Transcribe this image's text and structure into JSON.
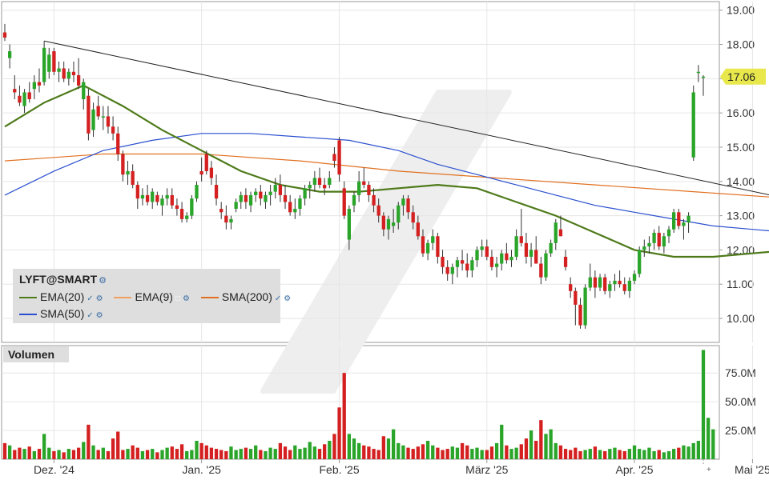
{
  "symbol": "LYFT@SMART",
  "colors": {
    "up": "#2aa52a",
    "down": "#d42020",
    "ema20": "#4e7a1a",
    "ema9": "#f0a060",
    "sma200": "#e07020",
    "sma50": "#2a4fcf",
    "trendline": "#222222",
    "last_price_bg": "#e8e84c"
  },
  "legend": {
    "title": "LYFT@SMART",
    "items": [
      {
        "label": "EMA(20)",
        "color": "#4e7a1a",
        "icons": [
          "check-icon",
          "gear-icon"
        ]
      },
      {
        "label": "EMA(9)",
        "color": "#f0a060",
        "icons": [
          "checkbox-empty-icon",
          "gear-icon"
        ]
      },
      {
        "label": "SMA(200)",
        "color": "#e07020",
        "icons": [
          "check-icon",
          "gear-icon"
        ]
      },
      {
        "label": "SMA(50)",
        "color": "#2a4fcf",
        "icons": [
          "check-icon",
          "gear-icon"
        ]
      }
    ]
  },
  "volume_panel": {
    "title": "Volumen"
  },
  "last_price_label": "17.06",
  "chart_data": {
    "type": "candlestick",
    "price_axis": {
      "ticks": [
        "10.00",
        "11.00",
        "12.00",
        "13.00",
        "14.00",
        "15.00",
        "16.00",
        "17.00",
        "18.00",
        "19.00"
      ],
      "range": [
        9.3,
        19.25
      ]
    },
    "volume_axis": {
      "ticks": [
        "25.0M",
        "50.0M",
        "75.0M"
      ],
      "range": [
        0,
        96
      ]
    },
    "x_labels": [
      "Dez. '24",
      "Jan. '25",
      "Feb. '25",
      "März '25",
      "Apr. '25",
      "Mai '25"
    ],
    "candles": [
      [
        18.35,
        18.6,
        18.1,
        18.2
      ],
      [
        17.6,
        18.0,
        17.3,
        17.8
      ],
      [
        16.7,
        17.1,
        16.4,
        16.6
      ],
      [
        16.5,
        16.8,
        16.2,
        16.3
      ],
      [
        16.2,
        16.7,
        16.0,
        16.6
      ],
      [
        16.6,
        16.9,
        16.3,
        16.4
      ],
      [
        16.7,
        17.1,
        16.4,
        16.9
      ],
      [
        16.9,
        17.3,
        16.6,
        16.8
      ],
      [
        16.9,
        18.1,
        16.8,
        17.9
      ],
      [
        17.2,
        17.9,
        17.0,
        17.7
      ],
      [
        17.8,
        17.9,
        17.1,
        17.2
      ],
      [
        17.2,
        17.5,
        16.9,
        17.3
      ],
      [
        17.3,
        17.5,
        16.9,
        17.0
      ],
      [
        17.0,
        17.3,
        16.8,
        17.2
      ],
      [
        17.2,
        17.5,
        16.9,
        17.1
      ],
      [
        17.1,
        17.6,
        16.7,
        16.8
      ],
      [
        16.4,
        17.0,
        16.1,
        16.9
      ],
      [
        16.5,
        16.7,
        15.2,
        15.4
      ],
      [
        15.5,
        16.3,
        15.3,
        16.1
      ],
      [
        16.2,
        16.5,
        15.8,
        15.9
      ],
      [
        15.9,
        16.2,
        15.5,
        15.9
      ],
      [
        15.9,
        16.2,
        15.4,
        15.6
      ],
      [
        15.6,
        15.9,
        15.2,
        15.4
      ],
      [
        15.4,
        15.6,
        14.6,
        14.8
      ],
      [
        14.8,
        14.9,
        14.0,
        14.2
      ],
      [
        14.2,
        14.6,
        13.9,
        14.3
      ],
      [
        14.3,
        14.5,
        13.8,
        13.9
      ],
      [
        13.9,
        14.0,
        13.2,
        13.5
      ],
      [
        13.5,
        13.8,
        13.3,
        13.6
      ],
      [
        13.6,
        13.9,
        13.3,
        13.4
      ],
      [
        13.4,
        13.8,
        13.2,
        13.7
      ],
      [
        13.6,
        13.7,
        13.3,
        13.4
      ],
      [
        13.3,
        13.6,
        13.0,
        13.5
      ],
      [
        13.5,
        13.8,
        13.3,
        13.6
      ],
      [
        13.6,
        13.8,
        13.2,
        13.3
      ],
      [
        13.3,
        13.5,
        13.0,
        13.2
      ],
      [
        13.2,
        13.4,
        12.8,
        12.9
      ],
      [
        12.9,
        13.1,
        12.8,
        13.0
      ],
      [
        13.0,
        13.6,
        12.9,
        13.5
      ],
      [
        13.5,
        14.0,
        13.4,
        13.9
      ],
      [
        14.3,
        14.7,
        14.0,
        14.2
      ],
      [
        14.8,
        14.9,
        14.2,
        14.3
      ],
      [
        14.4,
        14.6,
        13.9,
        14.1
      ],
      [
        13.9,
        14.2,
        13.3,
        13.5
      ],
      [
        13.2,
        13.4,
        12.9,
        13.1
      ],
      [
        13.0,
        13.3,
        12.6,
        12.8
      ],
      [
        12.8,
        13.0,
        12.6,
        12.9
      ],
      [
        13.2,
        13.5,
        13.1,
        13.4
      ],
      [
        13.4,
        13.7,
        13.2,
        13.6
      ],
      [
        13.6,
        13.8,
        13.2,
        13.4
      ],
      [
        13.3,
        13.7,
        13.1,
        13.6
      ],
      [
        13.6,
        13.8,
        13.4,
        13.7
      ],
      [
        13.7,
        13.9,
        13.3,
        13.5
      ],
      [
        13.4,
        13.7,
        13.2,
        13.6
      ],
      [
        13.6,
        13.9,
        13.3,
        13.7
      ],
      [
        13.7,
        14.1,
        13.5,
        13.9
      ],
      [
        13.9,
        14.2,
        13.4,
        13.6
      ],
      [
        13.6,
        13.9,
        13.2,
        13.4
      ],
      [
        13.4,
        13.6,
        13.0,
        13.1
      ],
      [
        13.1,
        13.5,
        12.9,
        13.2
      ],
      [
        13.2,
        13.6,
        13.0,
        13.5
      ],
      [
        13.5,
        13.9,
        13.3,
        13.8
      ],
      [
        13.8,
        14.0,
        13.5,
        13.9
      ],
      [
        13.9,
        14.3,
        13.7,
        14.1
      ],
      [
        14.1,
        14.4,
        13.8,
        13.9
      ],
      [
        13.9,
        14.1,
        13.6,
        13.8
      ],
      [
        13.9,
        14.3,
        13.8,
        14.1
      ],
      [
        14.8,
        15.0,
        14.4,
        14.6
      ],
      [
        15.2,
        15.3,
        14.0,
        14.2
      ],
      [
        13.8,
        14.0,
        12.9,
        13.0
      ],
      [
        12.3,
        13.3,
        12.0,
        13.2
      ],
      [
        13.3,
        13.7,
        13.1,
        13.6
      ],
      [
        13.6,
        14.3,
        13.4,
        14.0
      ],
      [
        14.0,
        14.4,
        13.8,
        13.9
      ],
      [
        13.9,
        14.0,
        13.4,
        13.6
      ],
      [
        13.6,
        13.8,
        13.1,
        13.3
      ],
      [
        13.3,
        13.5,
        12.8,
        13.0
      ],
      [
        13.0,
        13.1,
        12.4,
        12.6
      ],
      [
        12.6,
        13.0,
        12.3,
        12.9
      ],
      [
        12.7,
        13.2,
        12.5,
        12.8
      ],
      [
        12.8,
        13.4,
        12.6,
        13.3
      ],
      [
        13.3,
        13.6,
        13.0,
        13.5
      ],
      [
        13.5,
        13.6,
        12.9,
        13.1
      ],
      [
        13.1,
        13.3,
        12.6,
        12.8
      ],
      [
        12.8,
        13.0,
        12.3,
        12.4
      ],
      [
        12.4,
        12.6,
        11.8,
        11.9
      ],
      [
        11.9,
        12.3,
        11.7,
        12.2
      ],
      [
        12.2,
        12.6,
        12.0,
        12.4
      ],
      [
        12.4,
        12.5,
        11.6,
        11.8
      ],
      [
        11.8,
        12.0,
        11.3,
        11.5
      ],
      [
        11.5,
        11.7,
        11.1,
        11.3
      ],
      [
        11.3,
        11.6,
        11.0,
        11.5
      ],
      [
        11.5,
        11.8,
        11.2,
        11.7
      ],
      [
        11.7,
        12.0,
        11.4,
        11.6
      ],
      [
        11.6,
        11.9,
        11.2,
        11.4
      ],
      [
        11.4,
        11.8,
        11.2,
        11.7
      ],
      [
        11.7,
        12.1,
        11.5,
        12.0
      ],
      [
        12.0,
        12.3,
        11.8,
        12.1
      ],
      [
        12.1,
        12.3,
        11.7,
        11.8
      ],
      [
        11.8,
        12.0,
        11.4,
        11.5
      ],
      [
        11.5,
        11.8,
        11.2,
        11.6
      ],
      [
        11.6,
        12.0,
        11.4,
        11.9
      ],
      [
        11.9,
        12.2,
        11.6,
        11.7
      ],
      [
        11.7,
        12.0,
        11.5,
        11.8
      ],
      [
        11.8,
        12.6,
        11.7,
        12.4
      ],
      [
        12.4,
        13.2,
        12.1,
        12.2
      ],
      [
        12.2,
        12.5,
        11.6,
        11.8
      ],
      [
        11.8,
        12.2,
        11.5,
        12.0
      ],
      [
        12.0,
        12.4,
        11.7,
        11.6
      ],
      [
        11.6,
        11.8,
        11.0,
        11.2
      ],
      [
        11.2,
        12.0,
        11.1,
        11.9
      ],
      [
        11.9,
        12.3,
        11.8,
        12.2
      ],
      [
        12.2,
        12.9,
        12.0,
        12.8
      ],
      [
        12.6,
        13.0,
        12.4,
        12.4
      ],
      [
        11.8,
        12.0,
        11.4,
        11.5
      ],
      [
        11.0,
        11.2,
        10.6,
        10.8
      ],
      [
        10.8,
        10.9,
        9.8,
        10.4
      ],
      [
        10.4,
        10.6,
        9.7,
        9.8
      ],
      [
        9.8,
        11.0,
        9.7,
        10.9
      ],
      [
        10.9,
        11.6,
        10.8,
        11.2
      ],
      [
        11.2,
        11.4,
        10.6,
        10.9
      ],
      [
        10.9,
        11.3,
        10.8,
        11.2
      ],
      [
        11.2,
        11.3,
        10.7,
        10.8
      ],
      [
        10.8,
        11.1,
        10.6,
        11.0
      ],
      [
        11.0,
        11.3,
        10.8,
        11.1
      ],
      [
        11.1,
        11.4,
        10.9,
        11.0
      ],
      [
        11.0,
        11.2,
        10.7,
        10.8
      ],
      [
        10.8,
        11.2,
        10.6,
        11.1
      ],
      [
        11.1,
        11.4,
        11.0,
        11.3
      ],
      [
        11.3,
        12.1,
        11.2,
        12.0
      ],
      [
        12.0,
        12.3,
        11.8,
        12.1
      ],
      [
        12.1,
        12.4,
        11.9,
        12.2
      ],
      [
        12.2,
        12.6,
        12.0,
        12.5
      ],
      [
        12.5,
        12.7,
        12.0,
        12.1
      ],
      [
        12.1,
        12.5,
        11.9,
        12.4
      ],
      [
        12.4,
        12.7,
        12.2,
        12.6
      ],
      [
        12.6,
        13.2,
        12.5,
        13.1
      ],
      [
        13.1,
        13.2,
        12.6,
        12.7
      ],
      [
        12.7,
        12.9,
        12.3,
        12.8
      ],
      [
        12.8,
        13.1,
        12.5,
        13.0
      ],
      [
        14.7,
        16.8,
        14.6,
        16.6
      ],
      [
        17.2,
        17.4,
        16.9,
        17.2
      ],
      [
        17.06,
        17.1,
        16.5,
        17.06
      ]
    ],
    "volumes": [
      14,
      12,
      8,
      10,
      9,
      11,
      7,
      9,
      22,
      10,
      7,
      8,
      6,
      9,
      8,
      10,
      15,
      30,
      12,
      8,
      10,
      7,
      18,
      24,
      8,
      9,
      12,
      10,
      7,
      8,
      9,
      6,
      8,
      10,
      11,
      9,
      13,
      7,
      8,
      16,
      14,
      12,
      10,
      9,
      8,
      7,
      11,
      8,
      9,
      10,
      9,
      12,
      8,
      7,
      10,
      9,
      14,
      11,
      8,
      12,
      9,
      10,
      15,
      11,
      9,
      13,
      16,
      22,
      45,
      75,
      22,
      18,
      14,
      12,
      11,
      9,
      8,
      20,
      18,
      26,
      14,
      12,
      10,
      9,
      11,
      13,
      16,
      12,
      10,
      8,
      9,
      11,
      10,
      14,
      12,
      9,
      10,
      8,
      8,
      11,
      14,
      30,
      12,
      9,
      10,
      13,
      18,
      25,
      16,
      34,
      22,
      26,
      14,
      12,
      9,
      8,
      10,
      7,
      8,
      9,
      11,
      8,
      7,
      9,
      10,
      8,
      7,
      9,
      12,
      9,
      8,
      10,
      7,
      8,
      6,
      7,
      9,
      10,
      12,
      11,
      14,
      16,
      95,
      36,
      26
    ],
    "ema20": [
      [
        0,
        15.6
      ],
      [
        8,
        16.3
      ],
      [
        16,
        16.8
      ],
      [
        24,
        16.2
      ],
      [
        32,
        15.5
      ],
      [
        40,
        14.9
      ],
      [
        48,
        14.3
      ],
      [
        56,
        13.9
      ],
      [
        64,
        13.7
      ],
      [
        72,
        13.7
      ],
      [
        80,
        13.8
      ],
      [
        88,
        13.9
      ],
      [
        96,
        13.8
      ],
      [
        104,
        13.4
      ],
      [
        112,
        13.0
      ],
      [
        120,
        12.5
      ],
      [
        128,
        12.0
      ],
      [
        136,
        11.8
      ],
      [
        144,
        11.8
      ],
      [
        152,
        11.9
      ],
      [
        160,
        12.0
      ],
      [
        168,
        11.8
      ],
      [
        176,
        11.6
      ],
      [
        184,
        11.4
      ],
      [
        192,
        11.2
      ],
      [
        200,
        11.2
      ],
      [
        208,
        11.5
      ],
      [
        216,
        11.9
      ],
      [
        224,
        12.2
      ],
      [
        230,
        13.0
      ],
      [
        234,
        13.4
      ]
    ],
    "sma50": [
      [
        0,
        13.6
      ],
      [
        10,
        14.3
      ],
      [
        20,
        14.9
      ],
      [
        30,
        15.2
      ],
      [
        40,
        15.4
      ],
      [
        50,
        15.4
      ],
      [
        60,
        15.3
      ],
      [
        70,
        15.2
      ],
      [
        80,
        14.9
      ],
      [
        88,
        14.5
      ],
      [
        96,
        14.2
      ],
      [
        104,
        13.9
      ],
      [
        112,
        13.6
      ],
      [
        120,
        13.3
      ],
      [
        128,
        13.1
      ],
      [
        136,
        12.9
      ],
      [
        144,
        12.7
      ],
      [
        152,
        12.6
      ],
      [
        160,
        12.5
      ],
      [
        168,
        12.4
      ],
      [
        176,
        12.3
      ],
      [
        184,
        12.2
      ],
      [
        192,
        12.0
      ],
      [
        200,
        11.9
      ],
      [
        208,
        11.8
      ],
      [
        216,
        11.8
      ],
      [
        222,
        11.85
      ],
      [
        228,
        11.9
      ],
      [
        234,
        12.1
      ]
    ],
    "sma200": [
      [
        0,
        14.6
      ],
      [
        10,
        14.7
      ],
      [
        20,
        14.8
      ],
      [
        40,
        14.8
      ],
      [
        60,
        14.6
      ],
      [
        80,
        14.3
      ],
      [
        100,
        14.1
      ],
      [
        120,
        13.9
      ],
      [
        140,
        13.7
      ],
      [
        160,
        13.5
      ],
      [
        180,
        13.3
      ],
      [
        200,
        13.15
      ],
      [
        220,
        13.1
      ],
      [
        234,
        13.15
      ]
    ],
    "trendline": [
      [
        8,
        18.1
      ],
      [
        195,
        12.4
      ]
    ]
  }
}
